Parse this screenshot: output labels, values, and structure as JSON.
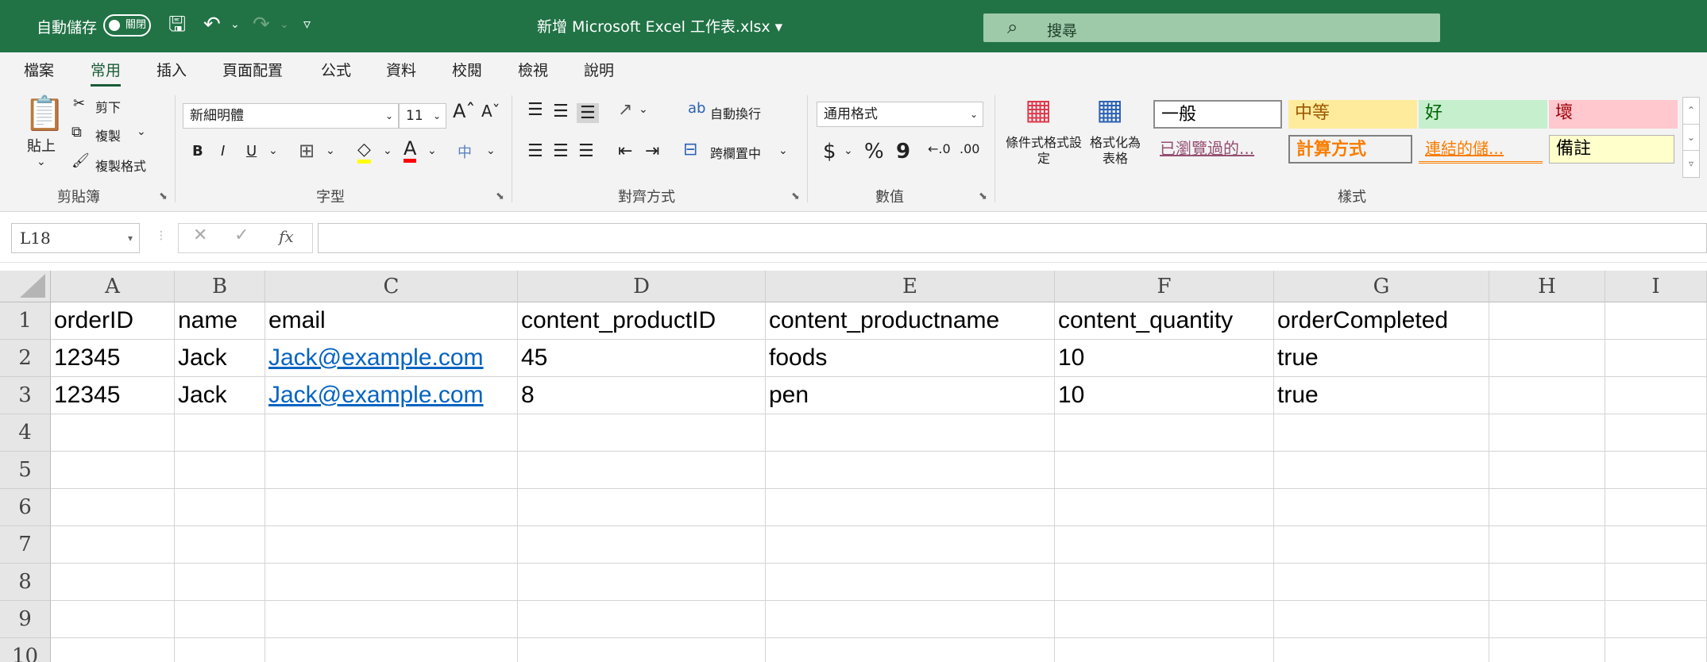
{
  "title_bar": {
    "autosave_label": "自動儲存",
    "autosave_toggle": "關閉",
    "file_title": "新增 Microsoft Excel 工作表.xlsx",
    "search_placeholder": "搜尋",
    "bg_color": "#217346"
  },
  "menu_tabs": [
    "檔案",
    "常用",
    "插入",
    "頁面配置",
    "公式",
    "資料",
    "校閱",
    "檢視",
    "說明"
  ],
  "active_tab": "常用",
  "ribbon": {
    "clipboard": {
      "paste": "貼上",
      "cut": "剪下",
      "copy": "複製",
      "format_painter": "複製格式",
      "label": "剪貼簿"
    },
    "font": {
      "font_name": "新細明體",
      "font_size": "11",
      "bold": "B",
      "italic": "I",
      "underline": "U",
      "label": "字型"
    },
    "alignment": {
      "wrap_text": "自動換行",
      "merge_center": "跨欄置中",
      "label": "對齊方式"
    },
    "number": {
      "format": "通用格式",
      "currency": "$",
      "percent": "%",
      "comma": "9",
      "label": "數值"
    },
    "styles": {
      "conditional_format": "條件式格式設定",
      "format_as_table": "格式化為表格",
      "cells": [
        {
          "text": "一般",
          "bg": "#ffffff",
          "color": "#000000"
        },
        {
          "text": "中等",
          "bg": "#ffeb9c",
          "color": "#9c5700"
        },
        {
          "text": "好",
          "bg": "#c6efce",
          "color": "#006100"
        },
        {
          "text": "壞",
          "bg": "#ffc7ce",
          "color": "#9c0006"
        },
        {
          "text": "已瀏覽過的...",
          "bg": "#f3f3f3",
          "color": "#954f72"
        },
        {
          "text": "計算方式",
          "bg": "#f2f2f2",
          "color": "#fa7d00"
        },
        {
          "text": "連結的儲...",
          "bg": "#f3f3f3",
          "color": "#fa7d00"
        },
        {
          "text": "備註",
          "bg": "#ffffcc",
          "color": "#000000"
        }
      ],
      "label": "樣式"
    }
  },
  "formula_bar": {
    "name_box": "L18",
    "fx": "fx",
    "content": ""
  },
  "sheet": {
    "columns": [
      "A",
      "B",
      "C",
      "D",
      "E",
      "F",
      "G",
      "H",
      "I"
    ],
    "row_numbers": [
      "1",
      "2",
      "3",
      "4",
      "5",
      "6",
      "7",
      "8",
      "9",
      "10"
    ],
    "rows": [
      [
        "orderID",
        "name",
        "email",
        "content_productID",
        "content_productname",
        "content_quantity",
        "orderCompleted",
        "",
        ""
      ],
      [
        "12345",
        "Jack",
        "Jack@example.com",
        "45",
        "foods",
        "10",
        "true",
        "",
        ""
      ],
      [
        "12345",
        "Jack",
        "Jack@example.com",
        "8",
        "pen",
        "10",
        "true",
        "",
        ""
      ]
    ],
    "link_color": "#0563c1"
  }
}
